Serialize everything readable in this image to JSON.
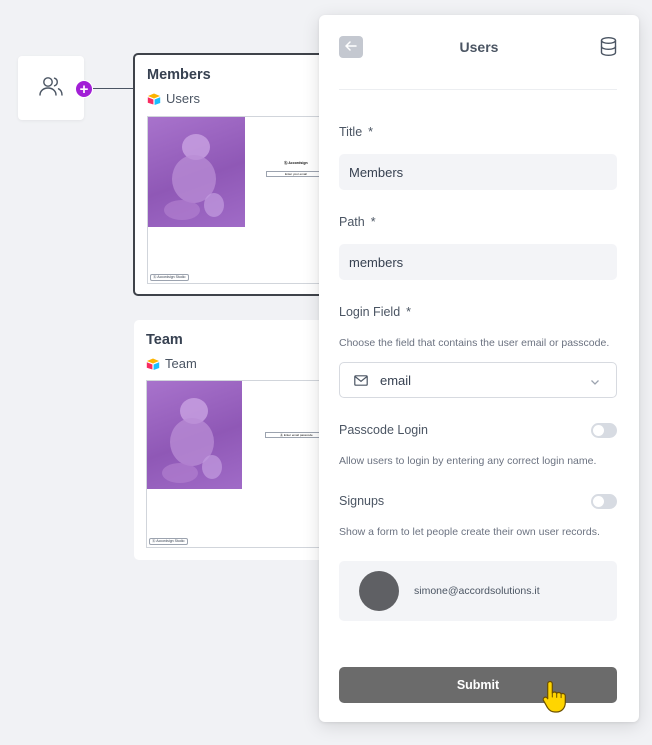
{
  "canvas": {
    "users_node": {
      "icon": "users-icon"
    },
    "add_button": {
      "icon": "plus-icon",
      "label": "+"
    },
    "cards": [
      {
        "title": "Members",
        "source_icon": "airtable-icon",
        "source_name": "Users",
        "preview": {
          "brand": "Ⓐ Accordsign",
          "field_hint": "Enter your email",
          "footer": "Ⓐ Accordsign Studio"
        }
      },
      {
        "title": "Team",
        "source_icon": "airtable-icon",
        "source_name": "Team",
        "preview": {
          "field_hint": "Ⓐ Enter email passcode",
          "footer": "Ⓐ Accordsign Studio"
        }
      }
    ]
  },
  "panel": {
    "back_icon": "arrow-left-icon",
    "title": "Users",
    "database_icon": "database-icon",
    "fields": {
      "title": {
        "label": "Title",
        "required_mark": "*",
        "value": "Members"
      },
      "path": {
        "label": "Path",
        "required_mark": "*",
        "value": "members"
      },
      "login_field": {
        "label": "Login Field",
        "required_mark": "*",
        "help": "Choose the field that contains the user email or passcode.",
        "selected": "email",
        "icon": "mail-icon",
        "chevron_icon": "chevron-down-icon"
      },
      "passcode_login": {
        "label": "Passcode Login",
        "help": "Allow users to login by entering any correct login name.",
        "enabled": false
      },
      "signups": {
        "label": "Signups",
        "help": "Show a form to let people create their own user records.",
        "enabled": false
      }
    },
    "user": {
      "email": "simone@accordsolutions.it"
    },
    "submit_label": "Submit"
  },
  "colors": {
    "accent": "#a21fd6",
    "submit_bg": "#6b6b6b",
    "input_bg": "#f3f4f7",
    "canvas_bg": "#f1f2f5"
  }
}
